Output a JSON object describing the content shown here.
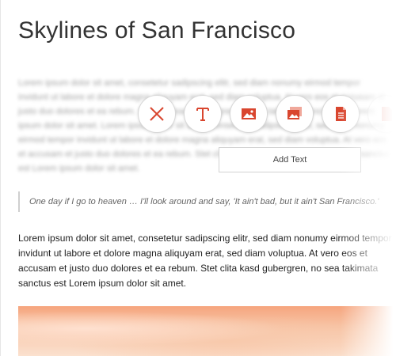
{
  "article": {
    "title": "Skylines of San Francisco",
    "blurred_text": "Lorem ipsum dolor sit amet, consetetur sadipscing elitr, sed diam nonumy eirmod tempor invidunt ut labore et dolore magna aliquyam erat, sed diam voluptua. At vero eos et accusam et justo duo dolores et ea rebum. Stet clita kasd gubergren, no sea takimata sanctus est Lorem ipsum dolor sit amet. Lorem ipsum dolor sit amet, consetetur sadipscing elitr, sed diam nonumy eirmod tempor invidunt ut labore et dolore magna aliquyam erat, sed diam voluptua. At vero eos et accusam et justo duo dolores et ea rebum. Stet clita kasd gubergren, no sea takimata sanctus est Lorem ipsum dolor sit amet.",
    "quote": "One day if I go to heaven … I'll look around and say, 'It ain't bad, but it ain't San Francisco.'",
    "paragraph": "Lorem ipsum dolor sit amet, consetetur sadipscing elitr, sed diam nonumy eirmod tempor invidunt ut labore et dolore magna aliquyam erat, sed diam voluptua. At vero eos et accusam et justo duo dolores et ea rebum. Stet clita kasd gubergren, no sea takimata sanctus est Lorem ipsum dolor sit amet."
  },
  "toolbar": {
    "accent_color": "#d9462f",
    "tools": [
      {
        "name": "close-icon"
      },
      {
        "name": "text-icon"
      },
      {
        "name": "image-icon"
      },
      {
        "name": "gallery-icon"
      },
      {
        "name": "document-icon"
      },
      {
        "name": "document-icon-faded"
      }
    ]
  },
  "add_text_label": "Add Text"
}
